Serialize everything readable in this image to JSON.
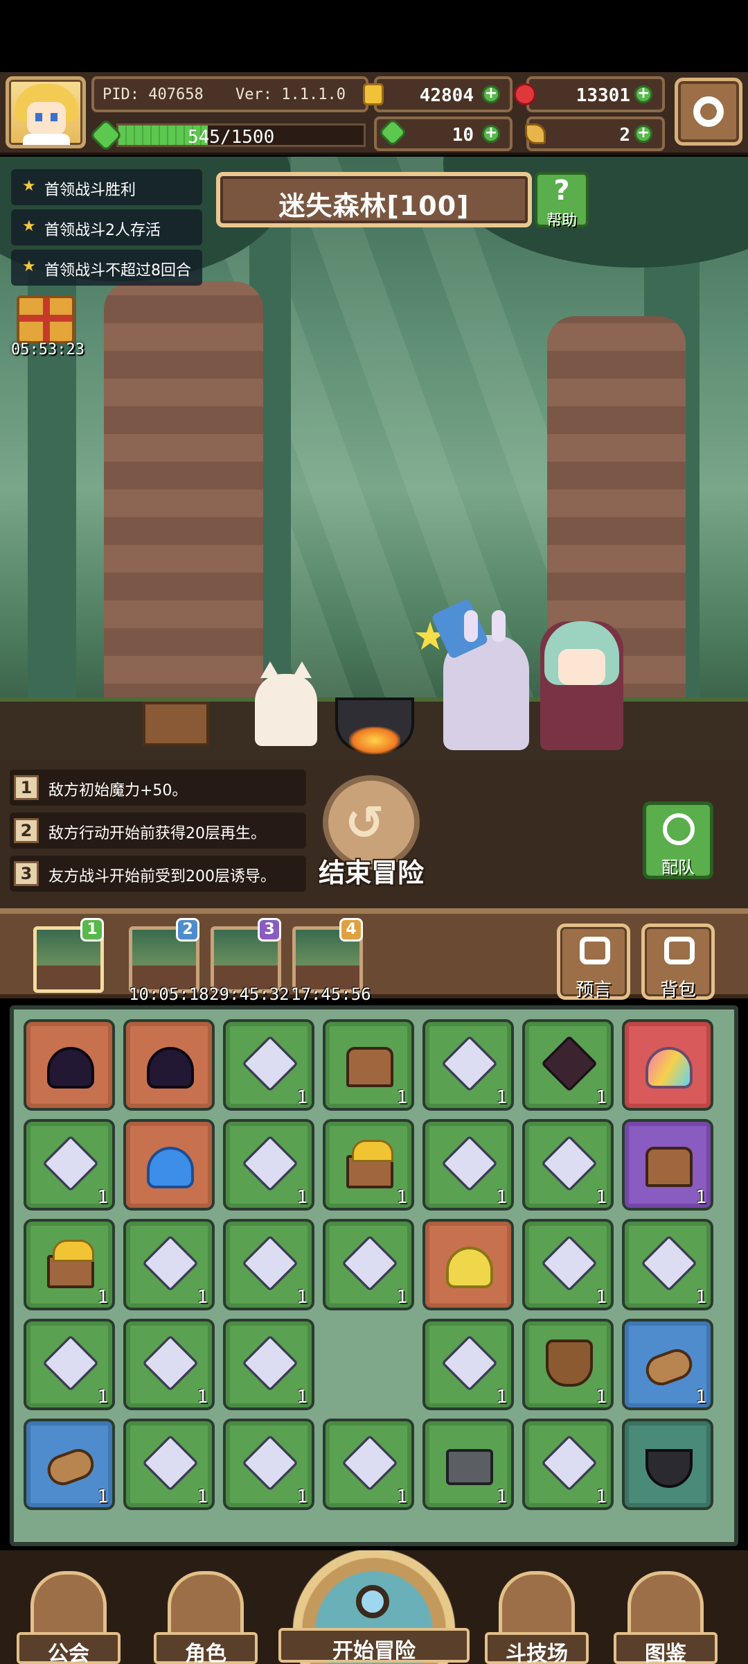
{
  "player": {
    "pid": "PID: 407658",
    "version": "Ver: 1.1.1.0",
    "energy_text": "545/1500",
    "energy_fraction": 0.363
  },
  "resources": {
    "gold": "42804",
    "ruby": "13301",
    "clover": "10",
    "feather": "2"
  },
  "bounties": [
    "首领战斗胜利",
    "首领战斗2人存活",
    "首领战斗不超过8回合"
  ],
  "gift": {
    "timer": "05:53:23"
  },
  "stage": {
    "title": "迷失森林[100]",
    "help_icon": "?",
    "help_label": "帮助"
  },
  "events": [
    {
      "num": "1",
      "text": "敌方初始魔力+50。"
    },
    {
      "num": "2",
      "text": "敌方行动开始前获得20层再生。"
    },
    {
      "num": "3",
      "text": "友方战斗开始前受到200层诱导。"
    }
  ],
  "actions": {
    "end_adventure_label": "结束冒险",
    "end_adventure_icon": "↺",
    "team_label": "配队"
  },
  "stages": [
    {
      "num": "1",
      "timer": "",
      "color": "#58b84a"
    },
    {
      "num": "2",
      "timer": "10:05:18",
      "color": "#4f8ccd"
    },
    {
      "num": "3",
      "timer": "29:45:32",
      "color": "#8a5bc0"
    },
    {
      "num": "4",
      "timer": "17:45:56",
      "color": "#e0a040"
    }
  ],
  "side_buttons": {
    "prophecy": "预言",
    "bag": "背包"
  },
  "inventory": [
    [
      {
        "type": "slime dark",
        "bg": "orange",
        "qty": ""
      },
      {
        "type": "slime dark",
        "bg": "orange",
        "qty": ""
      },
      {
        "type": "crystal",
        "bg": "green",
        "qty": "1"
      },
      {
        "type": "chest",
        "bg": "green",
        "qty": "1"
      },
      {
        "type": "crystal",
        "bg": "green",
        "qty": "1"
      },
      {
        "type": "dark-crystal",
        "bg": "green",
        "qty": "1"
      },
      {
        "type": "slime rainbow",
        "bg": "red",
        "qty": ""
      }
    ],
    [
      {
        "type": "crystal",
        "bg": "green",
        "qty": "1"
      },
      {
        "type": "slime blue",
        "bg": "orange",
        "qty": ""
      },
      {
        "type": "crystal",
        "bg": "green",
        "qty": "1"
      },
      {
        "type": "treasure",
        "bg": "green",
        "qty": "1"
      },
      {
        "type": "crystal",
        "bg": "green",
        "qty": "1"
      },
      {
        "type": "crystal",
        "bg": "green",
        "qty": "1"
      },
      {
        "type": "chest",
        "bg": "purple",
        "qty": "1"
      }
    ],
    [
      {
        "type": "treasure",
        "bg": "green",
        "qty": "1"
      },
      {
        "type": "crystal",
        "bg": "green",
        "qty": "1"
      },
      {
        "type": "crystal",
        "bg": "green",
        "qty": "1"
      },
      {
        "type": "crystal",
        "bg": "green",
        "qty": "1"
      },
      {
        "type": "slime gold",
        "bg": "orange",
        "qty": ""
      },
      {
        "type": "crystal",
        "bg": "green",
        "qty": "1"
      },
      {
        "type": "crystal",
        "bg": "green",
        "qty": "1"
      }
    ],
    [
      {
        "type": "crystal",
        "bg": "green",
        "qty": "1"
      },
      {
        "type": "crystal",
        "bg": "green",
        "qty": "1"
      },
      {
        "type": "crystal",
        "bg": "green",
        "qty": "1"
      },
      {
        "type": "",
        "bg": "empty",
        "qty": ""
      },
      {
        "type": "crystal",
        "bg": "green",
        "qty": "1"
      },
      {
        "type": "leather",
        "bg": "green",
        "qty": "1"
      },
      {
        "type": "log",
        "bg": "blue",
        "qty": "1"
      }
    ],
    [
      {
        "type": "log",
        "bg": "blue",
        "qty": "1"
      },
      {
        "type": "crystal",
        "bg": "green",
        "qty": "1"
      },
      {
        "type": "crystal",
        "bg": "green",
        "qty": "1"
      },
      {
        "type": "crystal",
        "bg": "green",
        "qty": "1"
      },
      {
        "type": "safe",
        "bg": "green",
        "qty": "1"
      },
      {
        "type": "crystal",
        "bg": "green",
        "qty": "1"
      },
      {
        "type": "cauldron",
        "bg": "special",
        "qty": ""
      }
    ]
  ],
  "nav": {
    "guild": "公会",
    "character": "角色",
    "start": "开始冒险",
    "arena": "斗技场",
    "codex": "图鉴"
  }
}
